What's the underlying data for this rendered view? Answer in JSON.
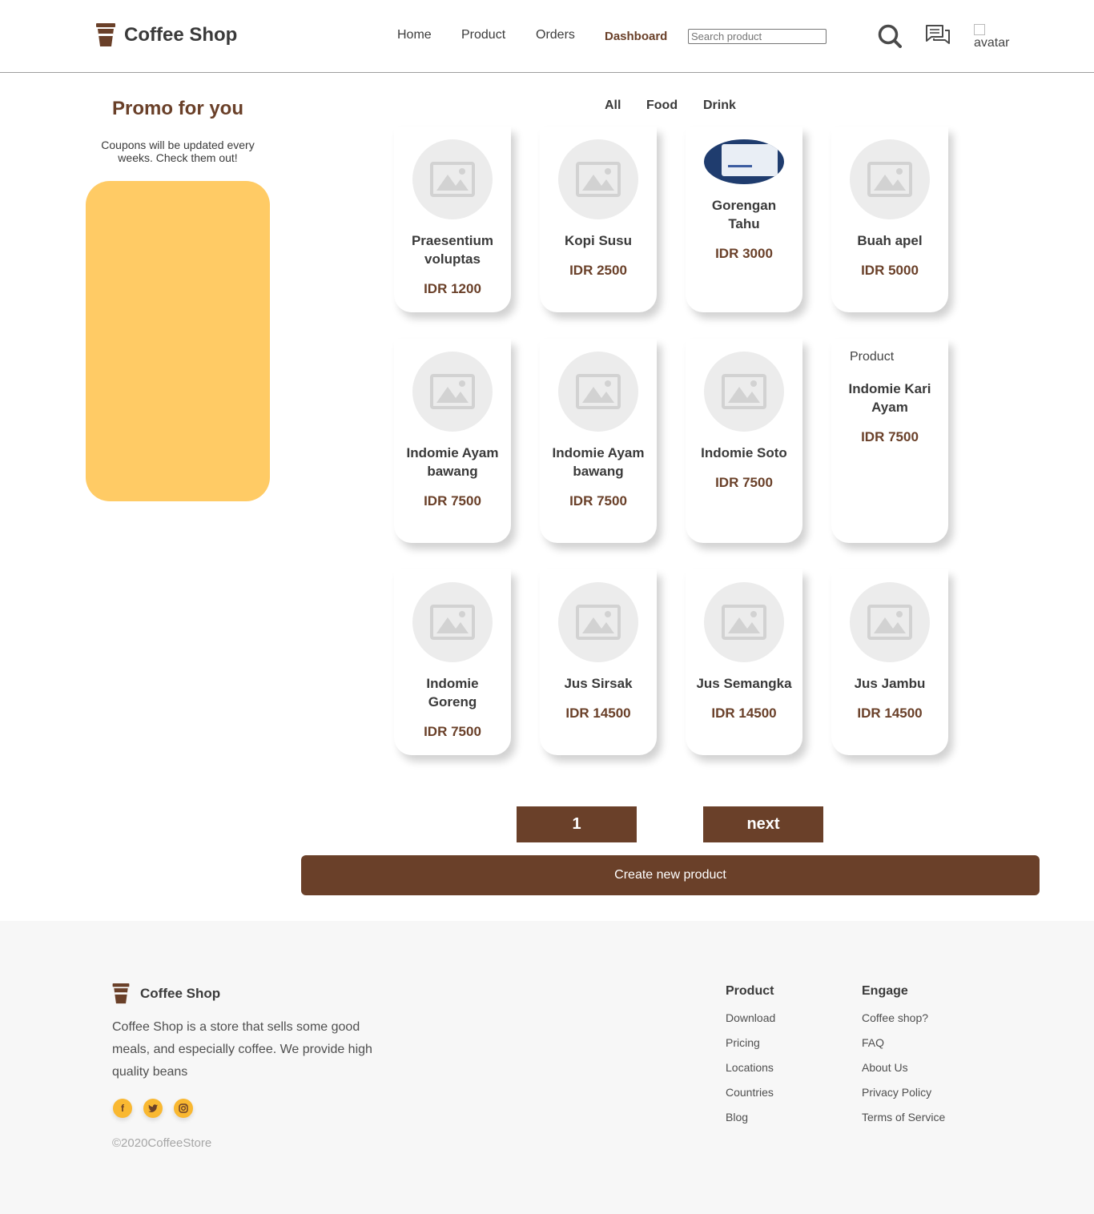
{
  "header": {
    "brand": "Coffee Shop",
    "nav": [
      {
        "label": "Home"
      },
      {
        "label": "Product"
      },
      {
        "label": "Orders"
      },
      {
        "label": "Dashboard"
      }
    ],
    "search_placeholder": "Search product",
    "avatar_alt": "avatar"
  },
  "promo": {
    "title": "Promo for you",
    "subtitle": "Coupons will be updated every weeks. Check them out!"
  },
  "filters": [
    "All",
    "Food",
    "Drink"
  ],
  "products": [
    {
      "name": "Praesentium voluptas",
      "price": "IDR 1200",
      "image": "placeholder"
    },
    {
      "name": "Kopi Susu",
      "price": "IDR 2500",
      "image": "placeholder"
    },
    {
      "name": "Gorengan Tahu",
      "price": "IDR 3000",
      "image": "photo"
    },
    {
      "name": "Buah apel",
      "price": "IDR 5000",
      "image": "placeholder"
    },
    {
      "name": "Indomie Ayam bawang",
      "price": "IDR 7500",
      "image": "placeholder"
    },
    {
      "name": "Indomie Ayam bawang",
      "price": "IDR 7500",
      "image": "placeholder"
    },
    {
      "name": "Indomie Soto",
      "price": "IDR 7500",
      "image": "placeholder"
    },
    {
      "name": "Indomie Kari Ayam",
      "price": "IDR 7500",
      "image": "broken",
      "image_alt": "Product"
    },
    {
      "name": "Indomie Goreng",
      "price": "IDR 7500",
      "image": "placeholder"
    },
    {
      "name": "Jus Sirsak",
      "price": "IDR 14500",
      "image": "placeholder"
    },
    {
      "name": "Jus Semangka",
      "price": "IDR 14500",
      "image": "placeholder"
    },
    {
      "name": "Jus Jambu",
      "price": "IDR 14500",
      "image": "placeholder"
    }
  ],
  "pagination": {
    "current": "1",
    "next": "next"
  },
  "create_button": "Create new product",
  "footer": {
    "brand": "Coffee Shop",
    "description": "Coffee Shop is a store that sells some good meals, and especially coffee. We provide high quality beans",
    "social": [
      {
        "icon": "facebook-icon",
        "glyph": "f"
      },
      {
        "icon": "twitter-icon",
        "glyph": "t"
      },
      {
        "icon": "instagram-icon",
        "glyph": "◙"
      }
    ],
    "copyright": "©2020CoffeeStore",
    "columns": [
      {
        "title": "Product",
        "items": [
          "Download",
          "Pricing",
          "Locations",
          "Countries",
          "Blog"
        ]
      },
      {
        "title": "Engage",
        "items": [
          "Coffee shop?",
          "FAQ",
          "About Us",
          "Privacy Policy",
          "Terms of Service"
        ]
      }
    ]
  },
  "colors": {
    "brown": "#6a4029",
    "promo_yellow": "#ffcb65",
    "social_yellow": "#f9b831"
  }
}
